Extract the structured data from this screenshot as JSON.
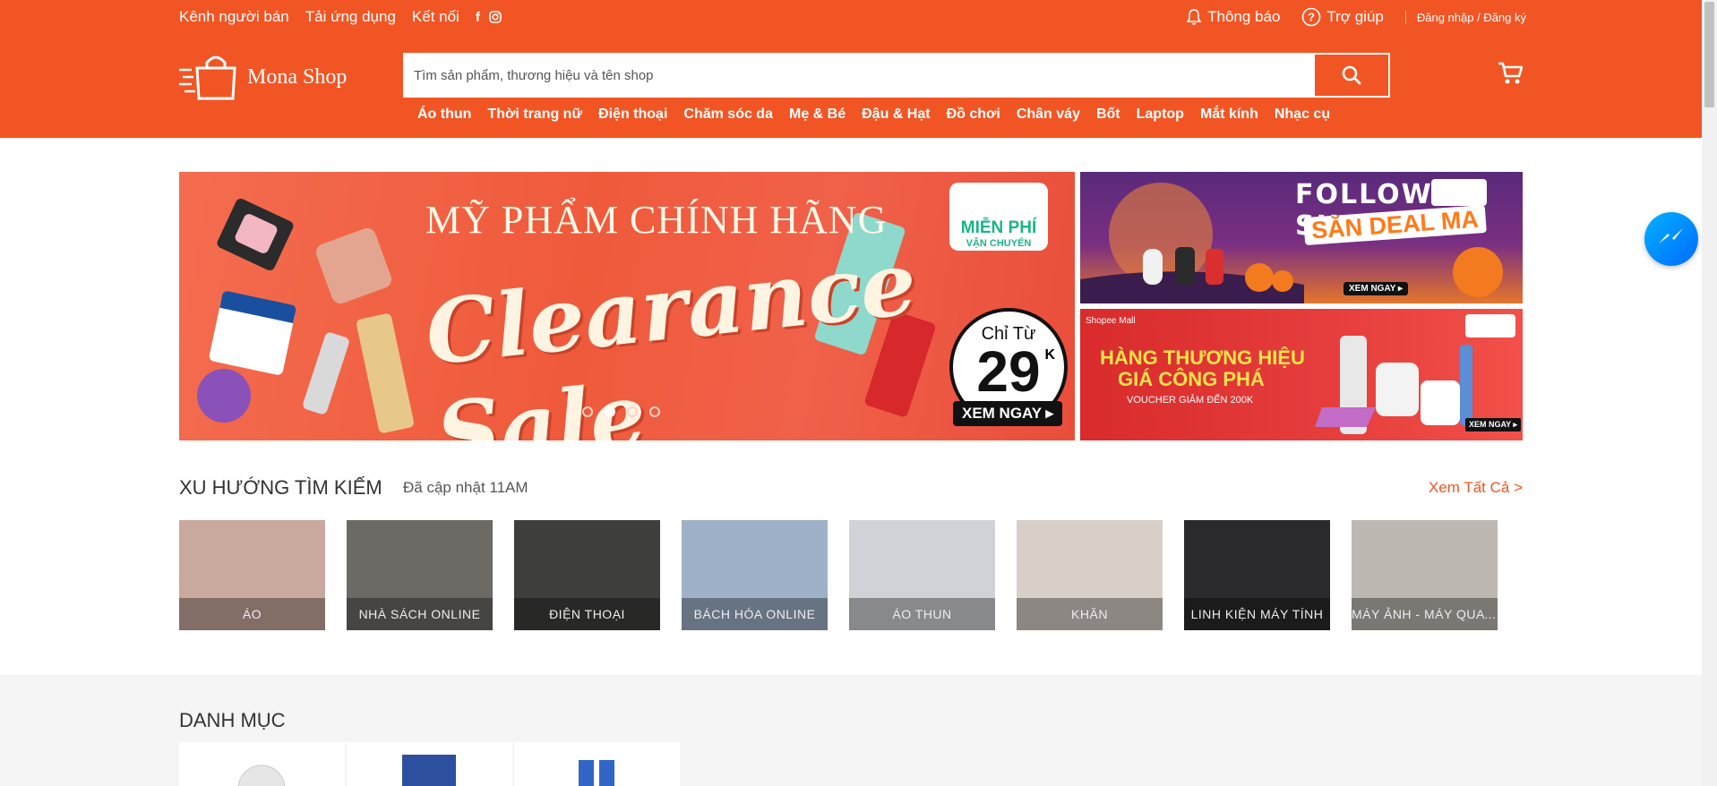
{
  "topbar": {
    "seller_channel": "Kênh người bán",
    "download_app": "Tải ứng dụng",
    "connect": "Kết nối",
    "facebook_glyph": "f",
    "notifications": "Thông báo",
    "help": "Trợ giúp",
    "auth": "Đăng nhập / Đăng ký"
  },
  "brand": {
    "name": "Mona Shop",
    "color": "#f25524"
  },
  "search": {
    "placeholder": "Tìm sản phẩm, thương hiệu và tên shop",
    "value": ""
  },
  "categories_nav": [
    "Áo thun",
    "Thời trang nữ",
    "Điện thoại",
    "Chăm sóc da",
    "Mẹ & Bé",
    "Đậu & Hạt",
    "Đồ chơi",
    "Chân váy",
    "Bốt",
    "Laptop",
    "Mắt kính",
    "Nhạc cụ"
  ],
  "banner_main": {
    "headline": "MỸ PHẨM CHÍNH HÃNG",
    "script": "Clearance Sale",
    "free_ship_line1": "MIỄN PHÍ",
    "free_ship_line2": "VẬN CHUYỂN",
    "from_label": "Chỉ Từ",
    "price": "29",
    "price_suffix": "K",
    "cta": "XEM NGAY",
    "slides_total": 4,
    "active_slide": 2
  },
  "banner_side1": {
    "line1": "FOLLOW SHOP",
    "line2": "SĂN DEAL MA",
    "cta": "XEM NGAY"
  },
  "banner_side2": {
    "mall": "Shopee Mall",
    "line1": "HÀNG THƯƠNG HIỆU",
    "line2": "GIÁ CÔNG PHÁ",
    "line3": "VOUCHER GIẢM ĐẾN 200K",
    "cta": "XEM NGAY"
  },
  "trending": {
    "title": "XU HƯỚNG TÌM KIẾM",
    "updated": "Đã cập nhật 11AM",
    "see_all": "Xem Tất Cả >",
    "items": [
      {
        "label": "ÁO",
        "bg": "#c9a89e"
      },
      {
        "label": "NHÀ SÁCH ONLINE",
        "bg": "#6d6a66"
      },
      {
        "label": "ĐIỆN THOẠI",
        "bg": "#3e3f3b"
      },
      {
        "label": "BÁCH HÓA ONLINE",
        "bg": "#9fb0c9"
      },
      {
        "label": "ÁO THUN",
        "bg": "#cfd3d8"
      },
      {
        "label": "KHĂN",
        "bg": "#d9cfc9"
      },
      {
        "label": "LINH KIỆN MÁY TÍNH",
        "bg": "#2a2a2c"
      },
      {
        "label": "MÁY ẢNH - MÁY QUAY ...",
        "bg": "#bdb8b2"
      }
    ]
  },
  "categories_section": {
    "title": "DANH MỤC"
  }
}
